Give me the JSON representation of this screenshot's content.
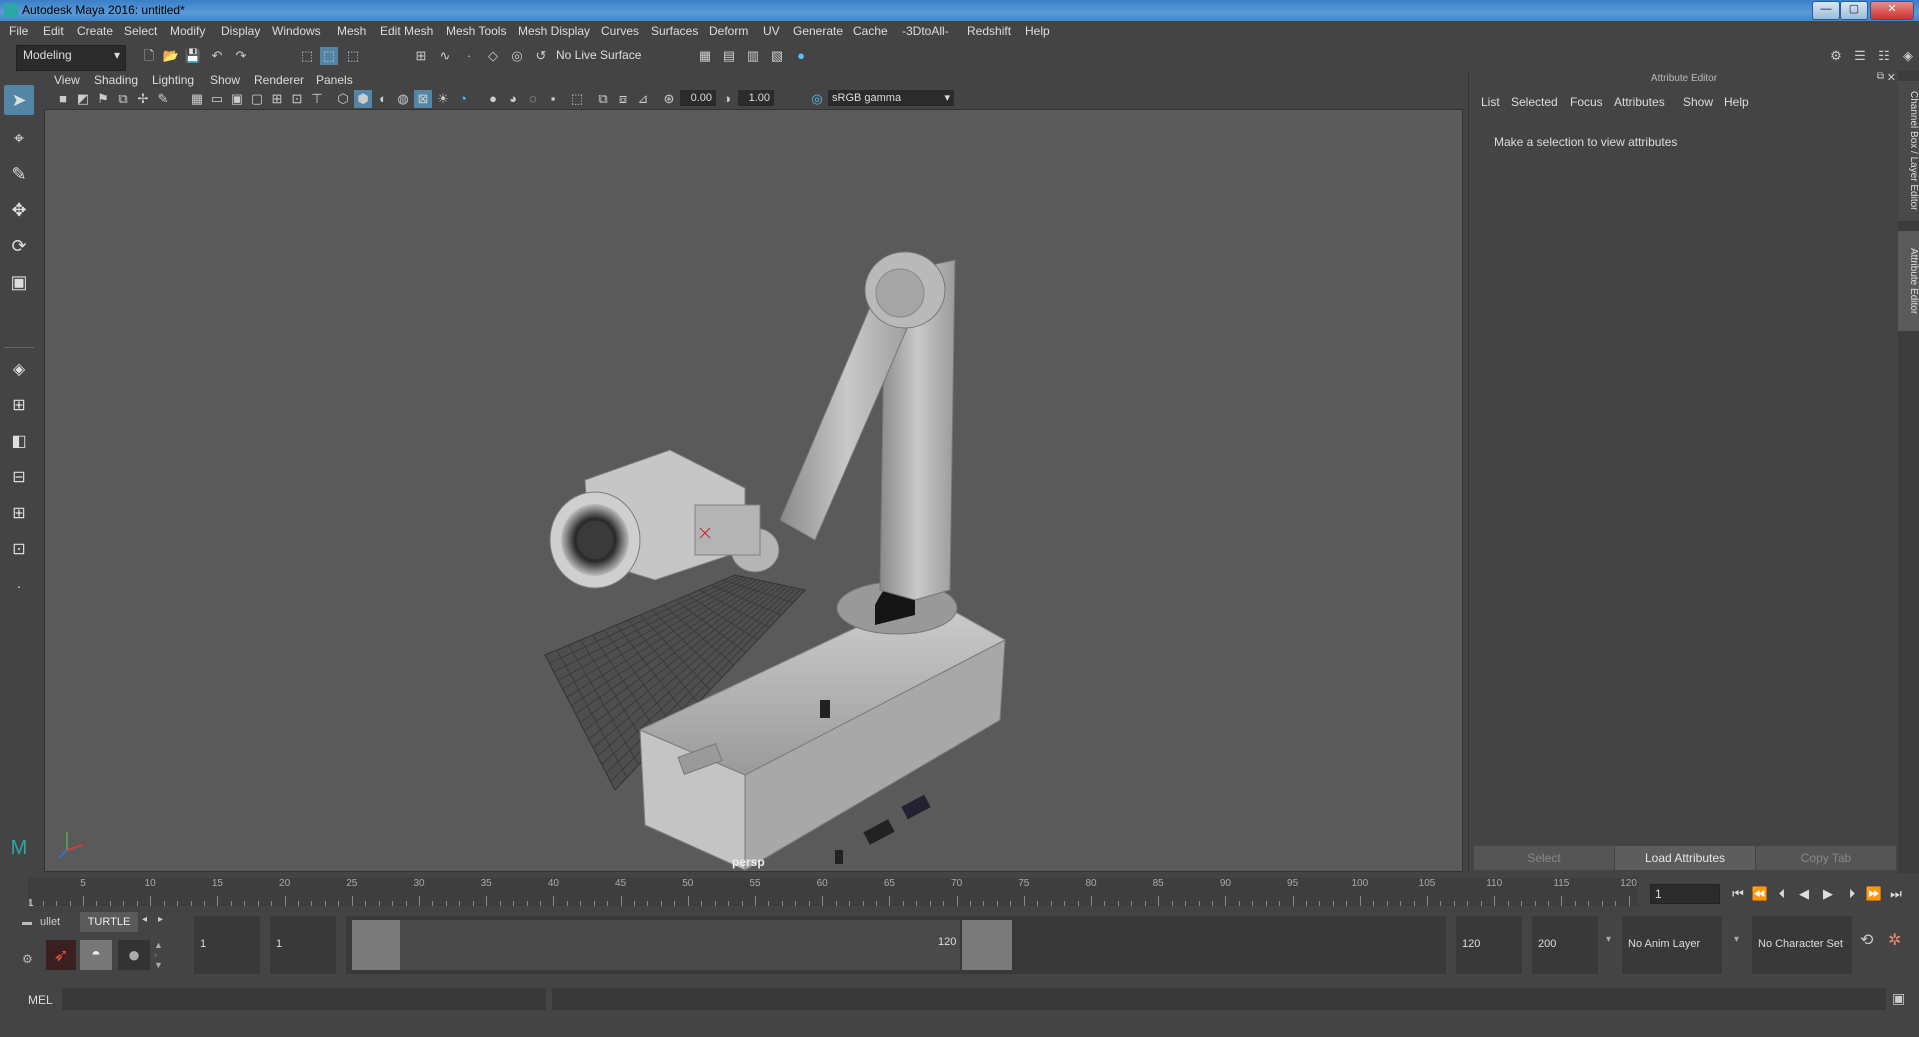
{
  "window": {
    "title": "Autodesk Maya 2016: untitled*",
    "buttons": [
      "—",
      "▢",
      "✕"
    ]
  },
  "menubar": [
    "File",
    "Edit",
    "Create",
    "Select",
    "Modify",
    "Display",
    "Windows",
    "Mesh",
    "Edit Mesh",
    "Mesh Tools",
    "Mesh Display",
    "Curves",
    "Surfaces",
    "Deform",
    "UV",
    "Generate",
    "Cache",
    "-3DtoAll-",
    "Redshift",
    "Help"
  ],
  "statusline": {
    "menuset": "Modeling",
    "live_surface": "No Live Surface"
  },
  "viewport": {
    "menus": [
      "View",
      "Shading",
      "Lighting",
      "Show",
      "Renderer",
      "Panels"
    ],
    "exposure": "0.00",
    "gamma": "1.00",
    "color_space": "sRGB gamma",
    "camera_label": "persp"
  },
  "attribute_editor": {
    "title": "Attribute Editor",
    "menus": [
      "List",
      "Selected",
      "Focus",
      "Attributes",
      "Show",
      "Help"
    ],
    "message": "Make a selection to view attributes",
    "buttons": {
      "select": "Select",
      "load": "Load Attributes",
      "copy": "Copy Tab"
    },
    "side_tabs": [
      "Channel Box / Layer Editor",
      "Attribute Editor"
    ]
  },
  "timeslider": {
    "ticks": [
      "5",
      "10",
      "15",
      "20",
      "25",
      "30",
      "35",
      "40",
      "45",
      "50",
      "55",
      "60",
      "65",
      "70",
      "75",
      "80",
      "85",
      "90",
      "95",
      "100",
      "105",
      "110",
      "115",
      "120"
    ],
    "start_label": "1",
    "current_frame": "1"
  },
  "shelf": {
    "tabs": [
      "ullet",
      "TURTLE"
    ]
  },
  "range": {
    "start": "1",
    "playback_start": "1",
    "slider_start": "1",
    "slider_end": "120",
    "playback_end": "120",
    "end": "200",
    "anim_layer": "No Anim Layer",
    "character_set": "No Character Set"
  },
  "cmdline": {
    "label": "MEL"
  }
}
